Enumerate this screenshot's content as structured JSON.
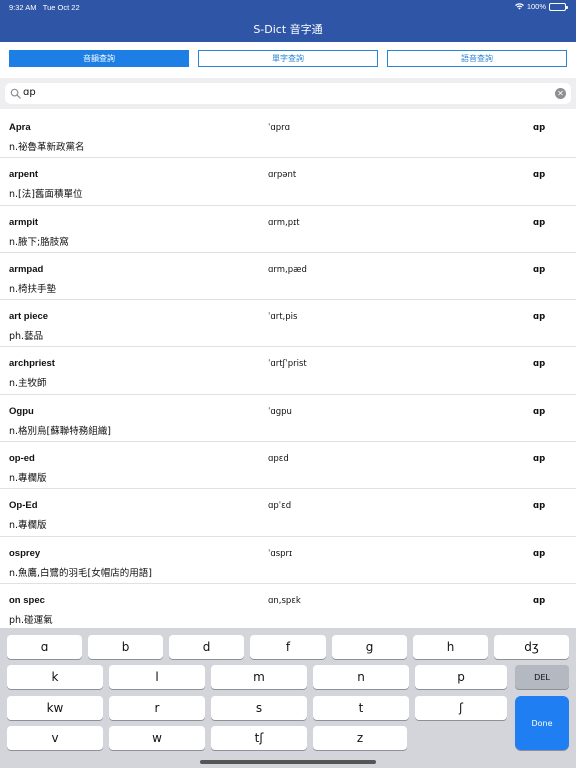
{
  "status": {
    "time": "9:32 AM",
    "date": "Tue Oct 22",
    "battery": "100%"
  },
  "header": {
    "title": "S-Dict 音字通"
  },
  "tabs": [
    {
      "label": "音韻查詢",
      "active": true
    },
    {
      "label": "單字查詢",
      "active": false
    },
    {
      "label": "語音查詢",
      "active": false
    }
  ],
  "search": {
    "value": "ɑp"
  },
  "results": [
    {
      "word": "Apra",
      "ipa": "ˈɑprɑ",
      "tag": "ɑp",
      "def": "n.祕魯革新政黨名"
    },
    {
      "word": "arpent",
      "ipa": "ɑrpənt",
      "tag": "ɑp",
      "def": "n.[法]舊面積單位"
    },
    {
      "word": "armpit",
      "ipa": "ɑrm,pɪt",
      "tag": "ɑp",
      "def": "n.腋下;胳肢窩"
    },
    {
      "word": "armpad",
      "ipa": "ɑrm,pæd",
      "tag": "ɑp",
      "def": "n.椅扶手墊"
    },
    {
      "word": "art piece",
      "ipa": "ˈɑrt,pis",
      "tag": "ɑp",
      "def": "ph.藝品"
    },
    {
      "word": "archpriest",
      "ipa": "ˈɑrtʃˈprist",
      "tag": "ɑp",
      "def": "n.主牧師"
    },
    {
      "word": "Ogpu",
      "ipa": "ˈɑgpu",
      "tag": "ɑp",
      "def": "n.格別烏[蘇聯特務組織]"
    },
    {
      "word": "op-ed",
      "ipa": "ɑpɛd",
      "tag": "ɑp",
      "def": "n.專欄版"
    },
    {
      "word": "Op-Ed",
      "ipa": "ɑpˈɛd",
      "tag": "ɑp",
      "def": "n.專欄版"
    },
    {
      "word": "osprey",
      "ipa": "ˈɑsprɪ",
      "tag": "ɑp",
      "def": "n.魚鷹,白鷺的羽毛[女帽店的用語]"
    },
    {
      "word": "on spec",
      "ipa": "ɑn,spɛk",
      "tag": "ɑp",
      "def": "ph.碰運氣"
    }
  ],
  "keyboard": {
    "row1": [
      "ɑ",
      "b",
      "d",
      "f",
      "g",
      "h",
      "dʒ"
    ],
    "row2": [
      "k",
      "l",
      "m",
      "n",
      "p"
    ],
    "del": "DEL",
    "row3": [
      "kw",
      "r",
      "s",
      "t",
      "ʃ"
    ],
    "row4": [
      "v",
      "w",
      "tʃ",
      "z"
    ],
    "done": "Done"
  },
  "colors": {
    "header": "#2f55a6",
    "accent": "#1d7fe5",
    "done": "#1e7ef2"
  }
}
